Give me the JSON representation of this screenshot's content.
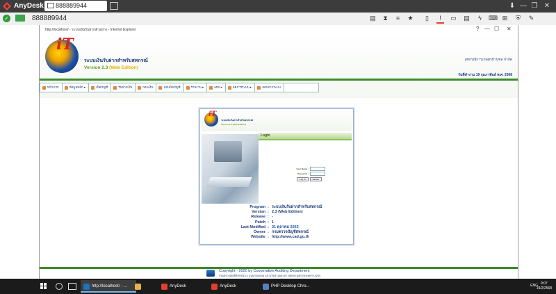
{
  "anydesk": {
    "app_name": "AnyDesk",
    "tab_label": "888889944",
    "address": "888889944",
    "window_controls": [
      "—",
      "❐",
      "✕"
    ],
    "toolbar_icons": [
      "chat-icon",
      "hourglass-icon",
      "database-icon",
      "star-icon",
      "file-icon",
      "alert-icon",
      "monitor-icon",
      "message-icon",
      "lightning-icon",
      "keyboard-icon",
      "shield-grid-icon",
      "security-icon",
      "edit-icon"
    ]
  },
  "ie": {
    "title": "http://localhost/ - ระบบเงินรับฝากตัวอย่าง - Internet Explorer",
    "controls": [
      "?",
      "—",
      "☐",
      "✕"
    ]
  },
  "header": {
    "logo_text": "iT",
    "system_name": "ระบบเงินรับฝากสำหรับสหกรณ์",
    "version_prefix": "Version",
    "version_num": "2.3",
    "edition": "(Web Edition)",
    "coop_name": "สหกรณ์การเกษตรบ้านขอ จำกัด",
    "date_text": "วันที่ทำงาน 19 กุมภาพันธ์ พ.ศ. 2568"
  },
  "menu": [
    {
      "label": "หน้าแรก"
    },
    {
      "label": "ข้อมูลหลัก ▸"
    },
    {
      "label": "เปิดบัญชี"
    },
    {
      "label": "รับฝากเงิน"
    },
    {
      "label": "ถอนเงิน"
    },
    {
      "label": "ถอนปิดบัญชี"
    },
    {
      "label": "รายงาน ▸"
    },
    {
      "label": "MIS ▸"
    },
    {
      "label": "จัดการระบบ ▸"
    },
    {
      "label": "ออกจากระบบ"
    }
  ],
  "login": {
    "mini_logo": "iT",
    "mini_system": "ระบบเงินรับฝากสำหรับสหกรณ์",
    "mini_version": "Version 2.3 (Web Edition)",
    "title": "Login",
    "user_label": "User Name :",
    "pass_label": "Password :",
    "user_value": "",
    "pass_value": "",
    "login_button": "Log In",
    "cancel_button": "Cancel",
    "info": [
      {
        "key": "Program",
        "value": "ระบบเงินรับฝากสำหรับสหกรณ์",
        "blue": false
      },
      {
        "key": "Version",
        "value": "2.3 (Web Edition)",
        "blue": false
      },
      {
        "key": "Release",
        "value": "-",
        "blue": false
      },
      {
        "key": "Patch",
        "value": "1",
        "blue": false
      },
      {
        "key": "Last Modified",
        "value": "31 ตุลาคม 2563",
        "blue": true
      },
      {
        "key": "Owner",
        "value": "กรมตรวจบัญชีสหกรณ์",
        "blue": false
      },
      {
        "key": "Website",
        "value": "http://www.cad.go.th",
        "blue": false
      }
    ]
  },
  "footer": {
    "copyright": "Copyright - 2020 by Cooperative Auditing Department",
    "address": "กรมตรวจบัญชีสหกรณ์ 12 ถนนกรุงเกษม แขวงวัดสามพระยา เขตพระนคร กรุงเทพฯ 10200"
  },
  "taskbar": {
    "apps": [
      {
        "label": "http://localhost/ - ...",
        "color": "#1e73be",
        "active": true
      },
      {
        "label": "",
        "color": "#e8b04a",
        "active": false
      },
      {
        "label": "AnyDesk",
        "color": "#e0412f",
        "active": false
      },
      {
        "label": "AnyDesk",
        "color": "#e0412f",
        "active": false
      },
      {
        "label": "PHP Desktop Chro...",
        "color": "#5a7fbf",
        "active": false
      }
    ],
    "tray_lang": "ENG",
    "time": "9:07",
    "date": "19/2/2568"
  }
}
